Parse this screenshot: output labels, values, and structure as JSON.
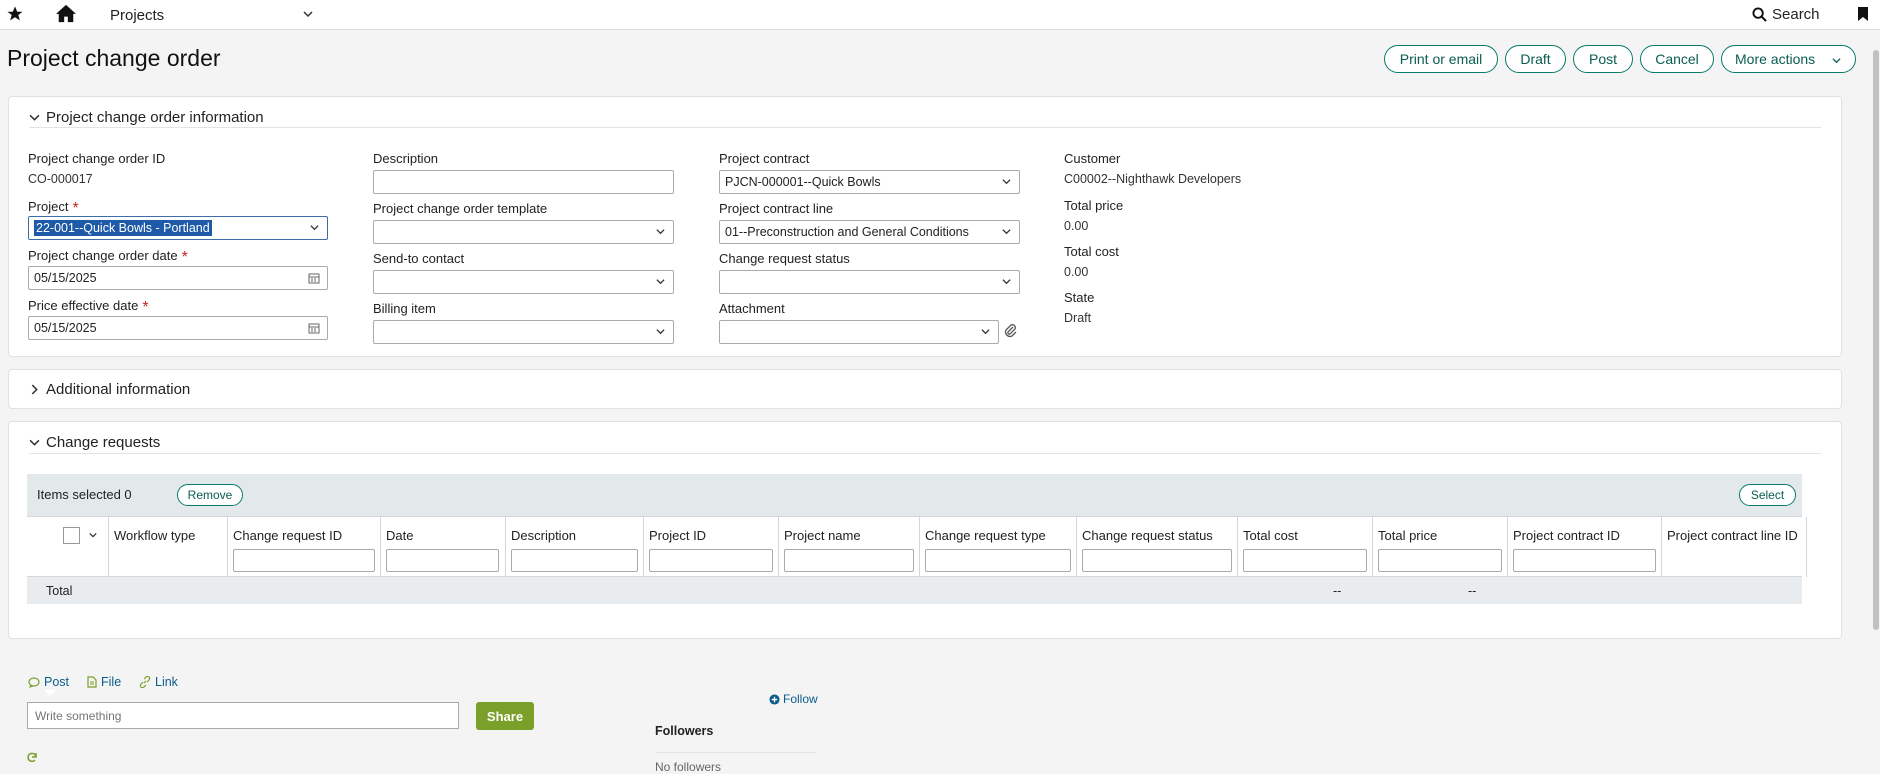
{
  "topbar": {
    "module": "Projects",
    "search_label": "Search"
  },
  "header": {
    "title": "Project change order",
    "buttons": {
      "print": "Print or email",
      "draft": "Draft",
      "post": "Post",
      "cancel": "Cancel",
      "more": "More actions"
    }
  },
  "info": {
    "section_title": "Project change order information",
    "co_id_label": "Project change order ID",
    "co_id_value": "CO-000017",
    "project_label": "Project",
    "project_value": "22-001--Quick Bowls - Portland",
    "co_date_label": "Project change order date",
    "co_date_value": "05/15/2025",
    "price_date_label": "Price effective date",
    "price_date_value": "05/15/2025",
    "description_label": "Description",
    "description_value": "",
    "template_label": "Project change order template",
    "template_value": "",
    "sendto_label": "Send-to contact",
    "sendto_value": "",
    "billing_label": "Billing item",
    "billing_value": "",
    "contract_label": "Project contract",
    "contract_value": "PJCN-000001--Quick Bowls",
    "contract_line_label": "Project contract line",
    "contract_line_value": "01--Preconstruction and General Conditions",
    "cr_status_label": "Change request status",
    "cr_status_value": "",
    "attachment_label": "Attachment",
    "attachment_value": "",
    "customer_label": "Customer",
    "customer_value": "C00002--Nighthawk Developers",
    "total_price_label": "Total price",
    "total_price_value": "0.00",
    "total_cost_label": "Total cost",
    "total_cost_value": "0.00",
    "state_label": "State",
    "state_value": "Draft"
  },
  "additional": {
    "section_title": "Additional information"
  },
  "change_requests": {
    "section_title": "Change requests",
    "items_selected": "Items selected 0",
    "remove_label": "Remove",
    "select_label": "Select",
    "columns": [
      "Workflow type",
      "Change request ID",
      "Date",
      "Description",
      "Project ID",
      "Project name",
      "Change request type",
      "Change request status",
      "Total cost",
      "Total price",
      "Project contract ID",
      "Project contract line ID"
    ],
    "total_label": "Total",
    "total_cost": "--",
    "total_price": "--"
  },
  "feed": {
    "post_tab": "Post",
    "file_tab": "File",
    "link_tab": "Link",
    "input_placeholder": "Write something",
    "share_label": "Share",
    "follow_label": "Follow",
    "followers_title": "Followers",
    "no_followers": "No followers"
  },
  "colors": {
    "accent": "#0a7a6a",
    "share_button": "#7ba02a",
    "selection": "#1e5aa8",
    "required": "#c62828"
  }
}
